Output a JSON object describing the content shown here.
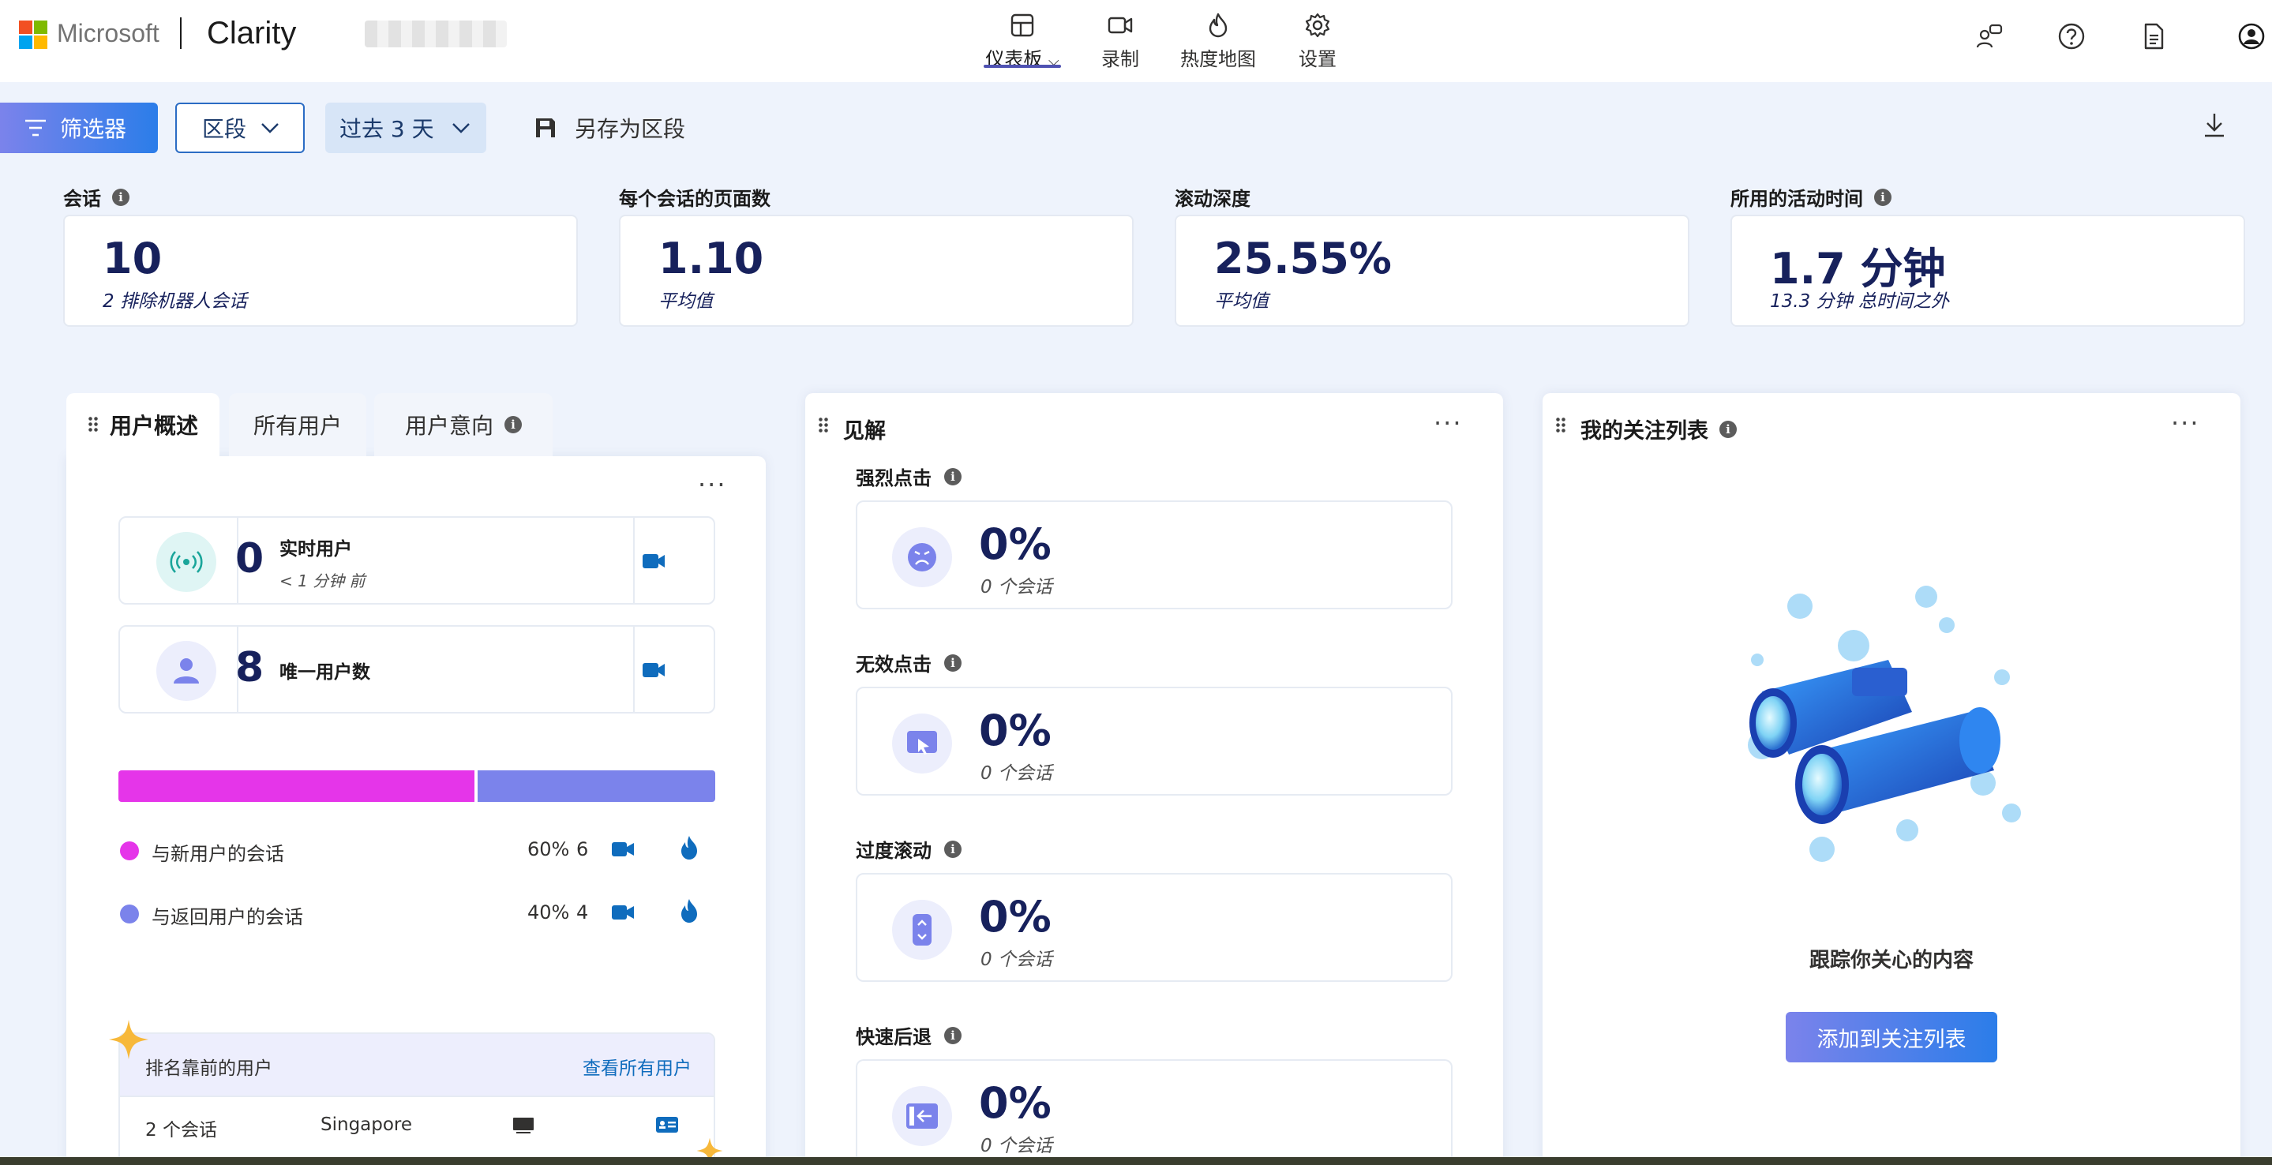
{
  "header": {
    "brand": "Microsoft",
    "app": "Clarity",
    "nav": [
      {
        "label": "仪表板",
        "icon": "dashboard-icon",
        "active": true
      },
      {
        "label": "录制",
        "icon": "video-icon"
      },
      {
        "label": "热度地图",
        "icon": "flame-icon"
      },
      {
        "label": "设置",
        "icon": "gear-icon"
      }
    ],
    "right_icons": [
      "people-icon",
      "help-icon",
      "document-icon",
      "account-icon"
    ]
  },
  "toolbar": {
    "filter_label": "筛选器",
    "segment_label": "区段",
    "range_label": "过去 3 天",
    "save_label": "另存为区段"
  },
  "metrics": [
    {
      "label": "会话",
      "value": "10",
      "sub": "2 排除机器人会话",
      "info": true
    },
    {
      "label": "每个会话的页面数",
      "value": "1.10",
      "sub": "平均值",
      "info": false
    },
    {
      "label": "滚动深度",
      "value": "25.55%",
      "sub": "平均值",
      "info": false
    },
    {
      "label": "所用的活动时间",
      "value": "1.7 分钟",
      "sub": "13.3 分钟 总时间之外",
      "info": true
    }
  ],
  "users_panel": {
    "tabs": [
      "用户概述",
      "所有用户",
      "用户意向"
    ],
    "live": {
      "value": "0",
      "label": "实时用户",
      "sub": "< 1 分钟 前"
    },
    "unique": {
      "value": "8",
      "label": "唯一用户数"
    },
    "split": {
      "new_pct": 60,
      "returning_pct": 40
    },
    "legend": [
      {
        "label": "与新用户的会话",
        "pct": "60%",
        "count": "6",
        "color": "#e535e9"
      },
      {
        "label": "与返回用户的会话",
        "pct": "40%",
        "count": "4",
        "color": "#7b83eb"
      }
    ],
    "top_users": {
      "title": "排名靠前的用户",
      "link": "查看所有用户",
      "rows": [
        {
          "sessions": "2 个会话",
          "location": "Singapore"
        }
      ]
    }
  },
  "insights_panel": {
    "title": "见解",
    "items": [
      {
        "label": "强烈点击",
        "value": "0%",
        "sub": "0 个会话",
        "icon": "angry-face-icon"
      },
      {
        "label": "无效点击",
        "value": "0%",
        "sub": "0 个会话",
        "icon": "cursor-click-icon"
      },
      {
        "label": "过度滚动",
        "value": "0%",
        "sub": "0 个会话",
        "icon": "scroll-icon"
      },
      {
        "label": "快速后退",
        "value": "0%",
        "sub": "0 个会话",
        "icon": "back-arrow-icon"
      }
    ]
  },
  "watchlist_panel": {
    "title": "我的关注列表",
    "message": "跟踪你关心的内容",
    "button": "添加到关注列表"
  }
}
